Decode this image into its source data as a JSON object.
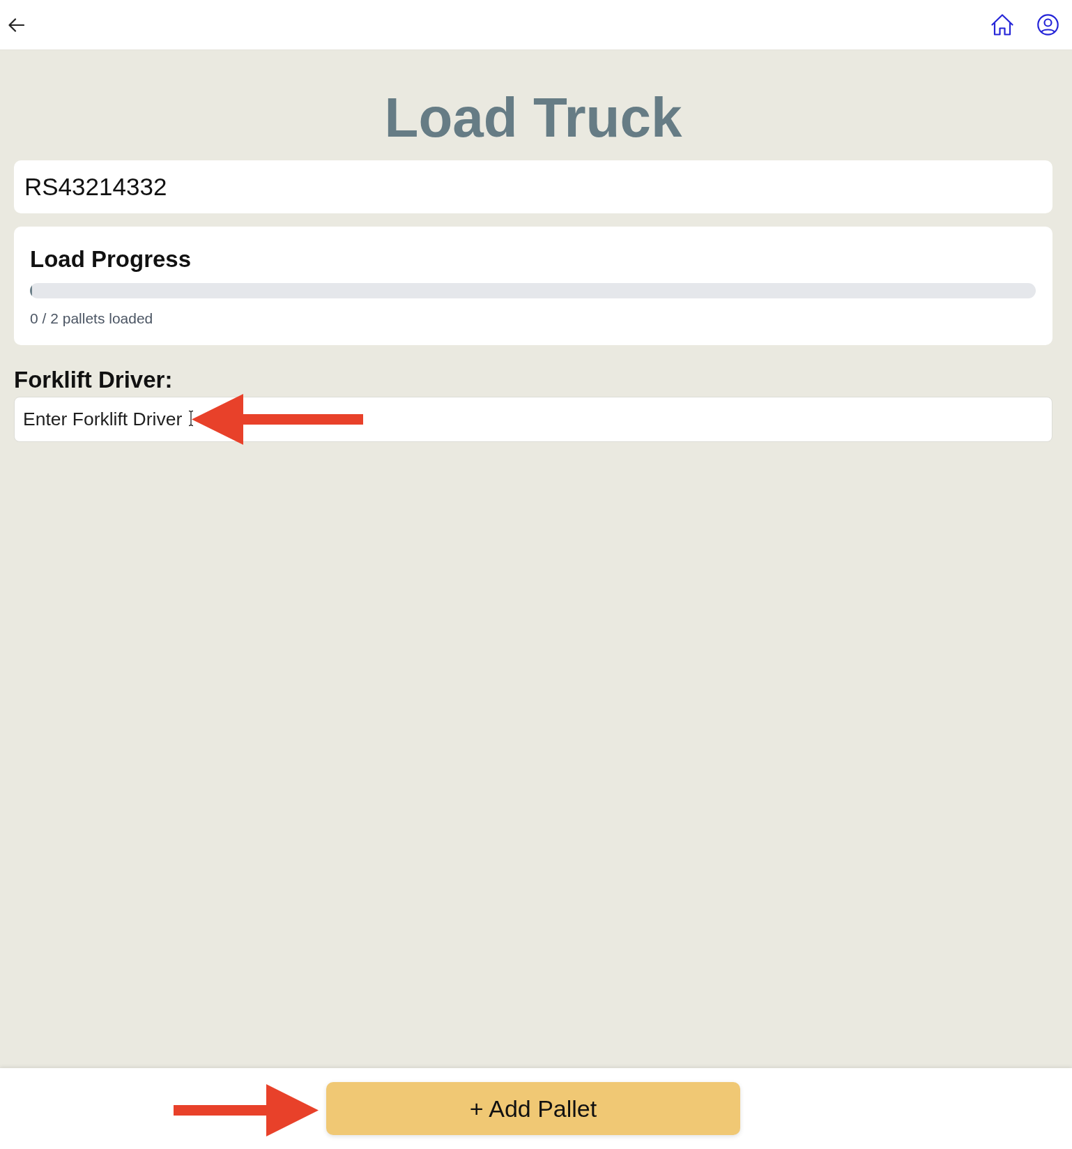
{
  "title": "Load Truck",
  "order_number": "RS43214332",
  "load_progress": {
    "title": "Load Progress",
    "level": 0,
    "caption": "0 / 2 pallets loaded"
  },
  "forklift_driver": {
    "label": "Forklift Driver:",
    "placeholder": "Enter Forklift Driver"
  },
  "footer": {
    "button": "+ Add Pallet"
  }
}
